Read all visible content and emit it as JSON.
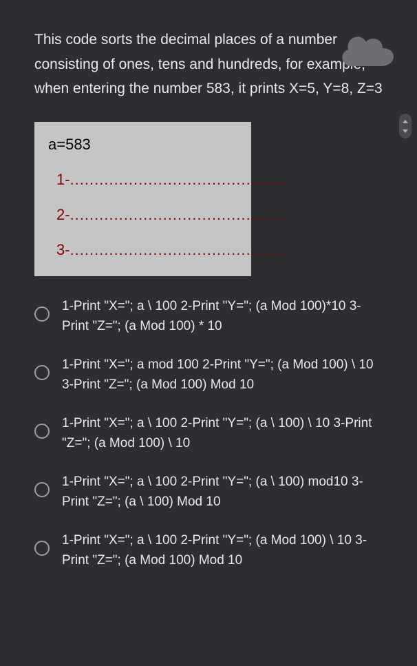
{
  "question": "This code sorts the decimal places of a number consisting of ones, tens and hundreds, for example, when entering the number 583, it prints X=5, Y=8, Z=3",
  "codeBox": {
    "var": "a=583",
    "line1_prefix": "1-",
    "line2_prefix": "2-",
    "line3_prefix": "3-",
    "dots": "............................................"
  },
  "options": [
    {
      "text": "1-Print \"X=\"; a \\ 100 2-Print \"Y=\"; (a Mod 100)*10 3-Print \"Z=\"; (a Mod 100) * 10"
    },
    {
      "text": "1-Print \"X=\"; a mod 100 2-Print \"Y=\"; (a Mod 100) \\ 10 3-Print \"Z=\"; (a Mod 100) Mod 10"
    },
    {
      "text": "1-Print \"X=\"; a \\ 100 2-Print \"Y=\"; (a \\ 100) \\ 10 3-Print \"Z=\"; (a Mod 100) \\ 10"
    },
    {
      "text": "1-Print \"X=\"; a \\ 100 2-Print \"Y=\"; (a \\ 100) mod10 3-Print \"Z=\"; (a \\ 100) Mod 10"
    },
    {
      "text": "1-Print \"X=\"; a \\ 100 2-Print \"Y=\"; (a Mod 100) \\ 10 3-Print \"Z=\"; (a Mod 100) Mod 10"
    }
  ]
}
